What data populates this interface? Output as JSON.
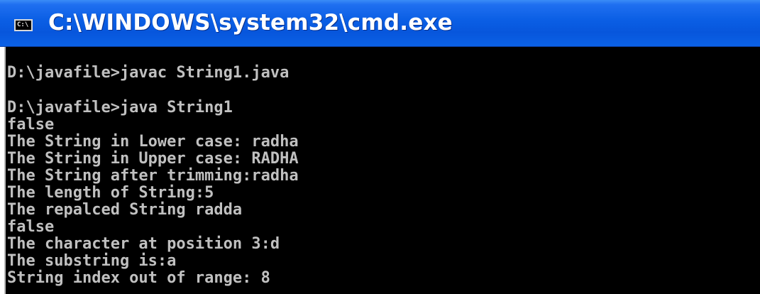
{
  "window": {
    "title": "C:\\WINDOWS\\system32\\cmd.exe",
    "icon": "cmd-icon",
    "icon_glyph": "C:\\"
  },
  "console": {
    "lines": [
      "D:\\javafile>javac String1.java",
      "D:\\javafile>java String1",
      "false",
      "The String in Lower case: radha",
      "The String in Upper case: RADHA",
      "The String after trimming:radha",
      "The length of String:5",
      "The repalced String radda",
      "false",
      "The character at position 3:d",
      "The substring is:a",
      "String index out of range: 8"
    ]
  },
  "colors": {
    "titlebar": "#0a5ee4",
    "console_bg": "#000000",
    "console_text": "#c0c0c0"
  }
}
